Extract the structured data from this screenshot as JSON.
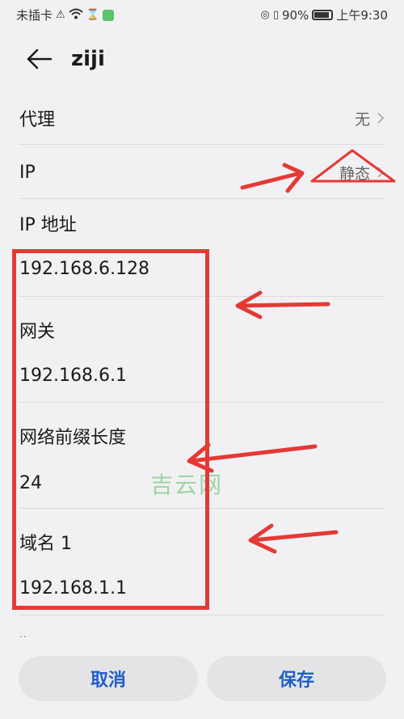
{
  "status_bar": {
    "carrier": "未插卡",
    "battery_percent": "90%",
    "time": "上午9:30"
  },
  "header": {
    "title": "ziji"
  },
  "proxy": {
    "label": "代理",
    "value": "无"
  },
  "ip": {
    "label": "IP",
    "value": "静态"
  },
  "ip_address": {
    "label": "IP 地址",
    "value": "192.168.6.128"
  },
  "gateway": {
    "label": "网关",
    "value": "192.168.6.1"
  },
  "prefix_length": {
    "label": "网络前缀长度",
    "value": "24"
  },
  "dns1": {
    "label": "域名 1",
    "value": "192.168.1.1"
  },
  "watermark": "吉云网",
  "buttons": {
    "cancel": "取消",
    "save": "保存"
  },
  "colors": {
    "accent": "#1f5fc8",
    "annotation_red": "#e53935",
    "background": "#f1f1f3"
  },
  "icons": [
    "back-arrow-icon",
    "chevron-right-icon",
    "wifi-icon",
    "battery-icon"
  ]
}
